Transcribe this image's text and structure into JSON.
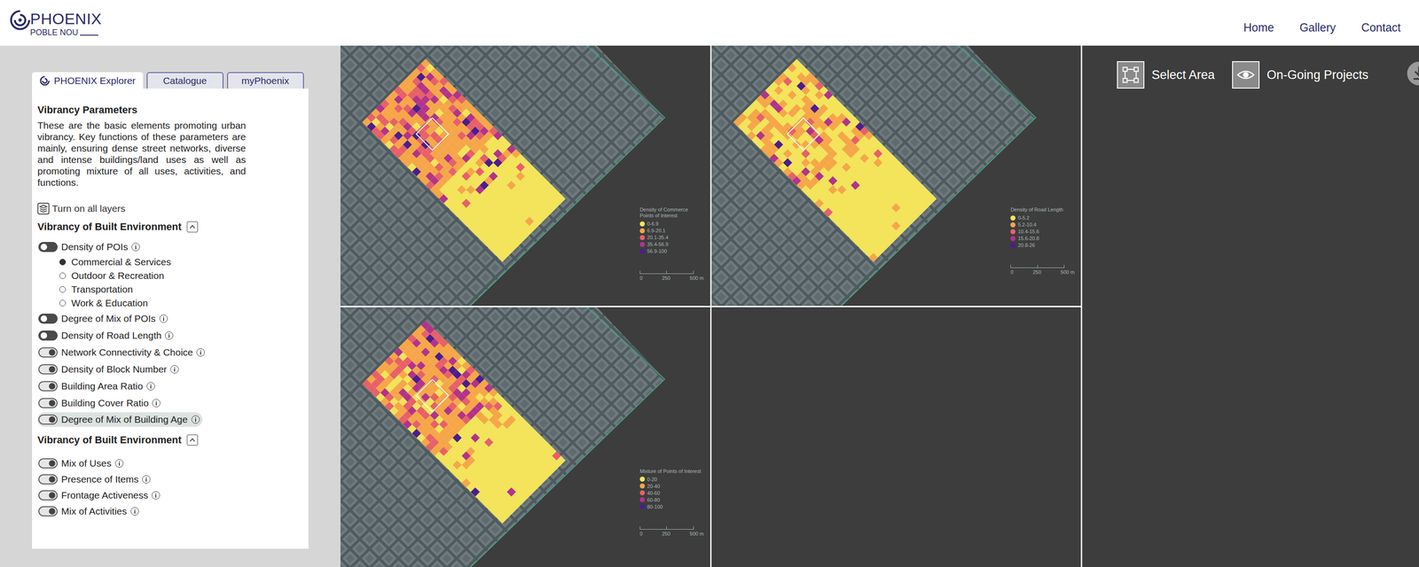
{
  "header": {
    "logo": {
      "title": "PHOENIX",
      "subtitle": "POBLE NOU"
    },
    "nav": [
      {
        "label": "Home"
      },
      {
        "label": "Gallery"
      },
      {
        "label": "Contact"
      }
    ]
  },
  "sidebar": {
    "tabs": [
      {
        "label": "PHOENIX Explorer",
        "selected": true
      },
      {
        "label": "Catalogue",
        "selected": false
      },
      {
        "label": "myPhoenix",
        "selected": false
      }
    ],
    "title": "Vibrancy Parameters",
    "description": "These are the basic elements promoting urban vibrancy. Key functions of these parameters are mainly, ensuring dense street networks, diverse and intense buildings/land uses as well as promoting mixture of all uses, activities, and functions.",
    "turn_on_all": "Turn on all layers",
    "sections": [
      {
        "title": "Vibrancy of Built Environment",
        "expanded": true,
        "items": [
          {
            "label": "Density of POIs",
            "on": true,
            "highlighted": false,
            "options": [
              {
                "label": "Commercial & Services",
                "selected": true
              },
              {
                "label": "Outdoor & Recreation",
                "selected": false
              },
              {
                "label": "Transportation",
                "selected": false
              },
              {
                "label": "Work & Education",
                "selected": false
              }
            ]
          },
          {
            "label": "Degree of Mix of POIs",
            "on": true,
            "highlighted": false,
            "options": []
          },
          {
            "label": "Density of Road Length",
            "on": true,
            "highlighted": false,
            "options": []
          },
          {
            "label": "Network Connectivity & Choice",
            "on": false,
            "highlighted": false,
            "options": []
          },
          {
            "label": "Density of Block Number",
            "on": false,
            "highlighted": false,
            "options": []
          },
          {
            "label": "Building Area Ratio",
            "on": false,
            "highlighted": false,
            "options": []
          },
          {
            "label": "Building Cover Ratio",
            "on": false,
            "highlighted": false,
            "options": []
          },
          {
            "label": "Degree of Mix of Building Age",
            "on": false,
            "highlighted": true,
            "options": []
          }
        ]
      },
      {
        "title": "Vibrancy of Built Environment",
        "expanded": true,
        "items": [
          {
            "label": "Mix of Uses",
            "on": false,
            "highlighted": false,
            "options": []
          },
          {
            "label": "Presence of Items",
            "on": false,
            "highlighted": false,
            "options": []
          },
          {
            "label": "Frontage Activeness",
            "on": false,
            "highlighted": false,
            "options": []
          },
          {
            "label": "Mix of Activities",
            "on": false,
            "highlighted": false,
            "options": []
          }
        ]
      }
    ]
  },
  "maps": [
    {
      "level": 0.75,
      "legend": {
        "title": "Density of Commerce Points of Interest",
        "entries": [
          {
            "label": "0-6.9",
            "color": "#f3e45c"
          },
          {
            "label": "6.9-20.1",
            "color": "#f6a64a"
          },
          {
            "label": "20.1-35.4",
            "color": "#e8606a"
          },
          {
            "label": "35.4-56.9",
            "color": "#b2338c"
          },
          {
            "label": "56.9-100",
            "color": "#4b1d8e"
          }
        ]
      },
      "scale": [
        "0",
        "250",
        "500 m"
      ]
    },
    {
      "level": 0.4,
      "legend": {
        "title": "Density of Road Length",
        "entries": [
          {
            "label": "0-5.2",
            "color": "#f3e45c"
          },
          {
            "label": "5.2-10.4",
            "color": "#f6a64a"
          },
          {
            "label": "10.4-15.6",
            "color": "#e8606a"
          },
          {
            "label": "15.6-20.8",
            "color": "#b2338c"
          },
          {
            "label": "20.8-26",
            "color": "#4b1d8e"
          }
        ]
      },
      "scale": [
        "0",
        "250",
        "500 m"
      ]
    },
    {
      "level": 0.7,
      "legend": {
        "title": "Mixture of Points of Interest",
        "entries": [
          {
            "label": "0-20",
            "color": "#f3e45c"
          },
          {
            "label": "20-40",
            "color": "#f6a64a"
          },
          {
            "label": "40-60",
            "color": "#e8606a"
          },
          {
            "label": "60-80",
            "color": "#b2338c"
          },
          {
            "label": "80-100",
            "color": "#4b1d8e"
          }
        ]
      },
      "scale": [
        "0",
        "250",
        "500 m"
      ]
    }
  ],
  "toolbar": {
    "buttons": [
      {
        "label": "Select Area"
      },
      {
        "label": "On-Going Projects"
      }
    ]
  }
}
